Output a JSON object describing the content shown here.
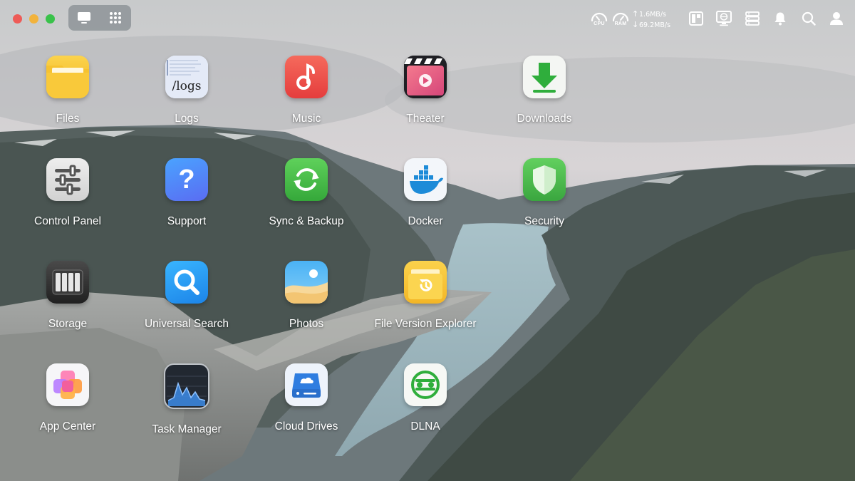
{
  "topbar": {
    "gauges": [
      {
        "label": "CPU"
      },
      {
        "label": "RAM"
      }
    ],
    "network": {
      "upload": "1.6MB/s",
      "download": "69.2MB/s"
    }
  },
  "apps": [
    {
      "name": "Files"
    },
    {
      "name": "Logs",
      "icon_text": "/logs"
    },
    {
      "name": "Music"
    },
    {
      "name": "Theater"
    },
    {
      "name": "Downloads"
    },
    {
      "name": "Control Panel"
    },
    {
      "name": "Support",
      "icon_text": "?"
    },
    {
      "name": "Sync & Backup"
    },
    {
      "name": "Docker"
    },
    {
      "name": "Security"
    },
    {
      "name": "Storage"
    },
    {
      "name": "Universal Search"
    },
    {
      "name": "Photos"
    },
    {
      "name": "File Version Explorer"
    },
    {
      "name": "App Center"
    },
    {
      "name": "Task Manager"
    },
    {
      "name": "Cloud Drives"
    },
    {
      "name": "DLNA"
    }
  ],
  "colors": {
    "traffic_red": "#ee5b57",
    "traffic_yellow": "#f2b33c",
    "traffic_green": "#39c24a"
  }
}
